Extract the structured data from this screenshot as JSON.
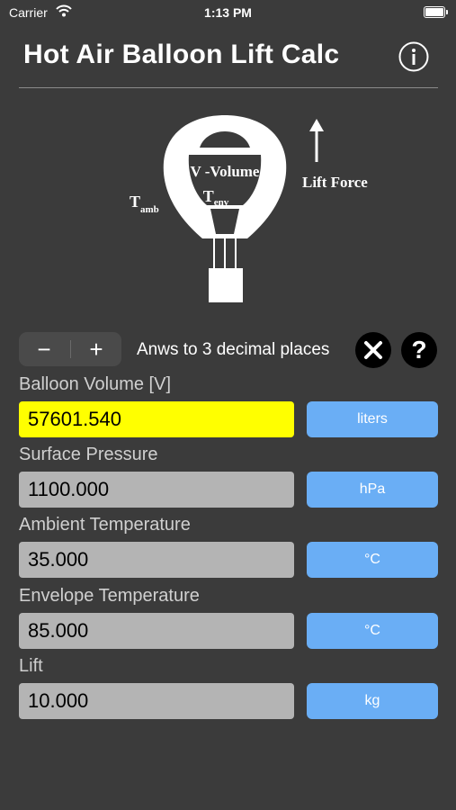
{
  "status": {
    "carrier": "Carrier",
    "time": "1:13 PM"
  },
  "app": {
    "title": "Hot Air Balloon Lift Calc",
    "info_icon": "info-circle-icon"
  },
  "diagram": {
    "volume_label": "V -Volume",
    "t_env": "T",
    "t_env_sub": "env",
    "t_amb": "T",
    "t_amb_sub": "amb",
    "lift_force": "Lift Force"
  },
  "controls": {
    "minus": "−",
    "plus": "+",
    "decimals_text": "Anws to 3 decimal places",
    "clear_icon": "close-circle-icon",
    "help_label": "?"
  },
  "fields": [
    {
      "label": "Balloon Volume [V]",
      "value": "57601.540",
      "unit": "liters",
      "active": true
    },
    {
      "label": "Surface Pressure",
      "value": "1100.000",
      "unit": "hPa",
      "active": false
    },
    {
      "label": "Ambient Temperature",
      "value": "35.000",
      "unit": "°C",
      "active": false
    },
    {
      "label": "Envelope Temperature",
      "value": "85.000",
      "unit": "°C",
      "active": false
    },
    {
      "label": "Lift",
      "value": "10.000",
      "unit": "kg",
      "active": false
    }
  ],
  "colors": {
    "background": "#3b3b3b",
    "active_field": "#ffff00",
    "field": "#b4b4b4",
    "unit_button": "#6aaef5"
  }
}
